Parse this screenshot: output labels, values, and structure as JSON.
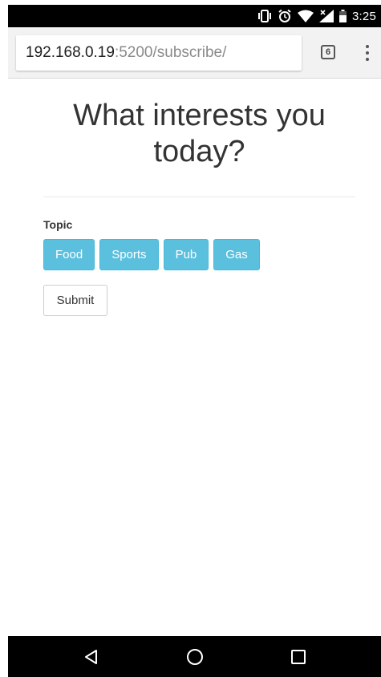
{
  "status_bar": {
    "time": "3:25",
    "icons": [
      "vibrate-icon",
      "alarm-icon",
      "wifi-icon",
      "signal-icon",
      "battery-icon"
    ]
  },
  "browser": {
    "url_host": "192.168.0.19",
    "url_rest": ":5200/subscribe/",
    "tab_count": "6"
  },
  "page": {
    "title": "What interests you today?",
    "topic_label": "Topic",
    "topics": [
      "Food",
      "Sports",
      "Pub",
      "Gas"
    ],
    "submit_label": "Submit"
  },
  "colors": {
    "topic_button": "#5bc0de",
    "status_bar": "#000000",
    "nav_bar": "#000000"
  },
  "nav_bar": {
    "icons": [
      "back-icon",
      "home-icon",
      "recents-icon"
    ]
  }
}
